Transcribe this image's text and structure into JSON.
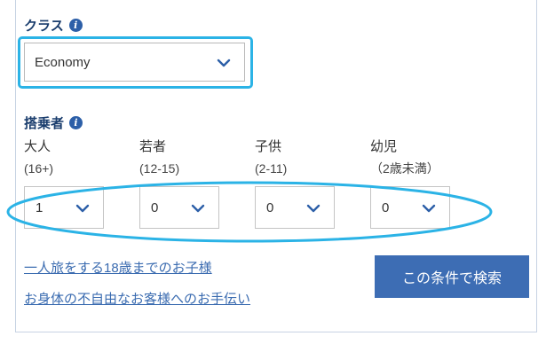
{
  "class_section": {
    "label": "クラス",
    "selected": "Economy"
  },
  "passengers_section": {
    "label": "搭乗者",
    "types": [
      {
        "name": "大人",
        "age": "(16+)",
        "value": "1"
      },
      {
        "name": "若者",
        "age": "(12-15)",
        "value": "0"
      },
      {
        "name": "子供",
        "age": "(2-11)",
        "value": "0"
      },
      {
        "name": "幼児",
        "age": "（2歳未満）",
        "value": "0"
      }
    ]
  },
  "links": {
    "unaccompanied_minor": "一人旅をする18歳までのお子様",
    "special_assistance": "お身体の不自由なお客様へのお手伝い"
  },
  "search_button": "この条件で検索",
  "icons": {
    "info": "info-icon",
    "dropdown": "chevron-down-icon"
  },
  "colors": {
    "accent": "#3d6db4",
    "highlight": "#2bb3e6",
    "label": "#1a3d6d",
    "link": "#3a6bb0"
  }
}
